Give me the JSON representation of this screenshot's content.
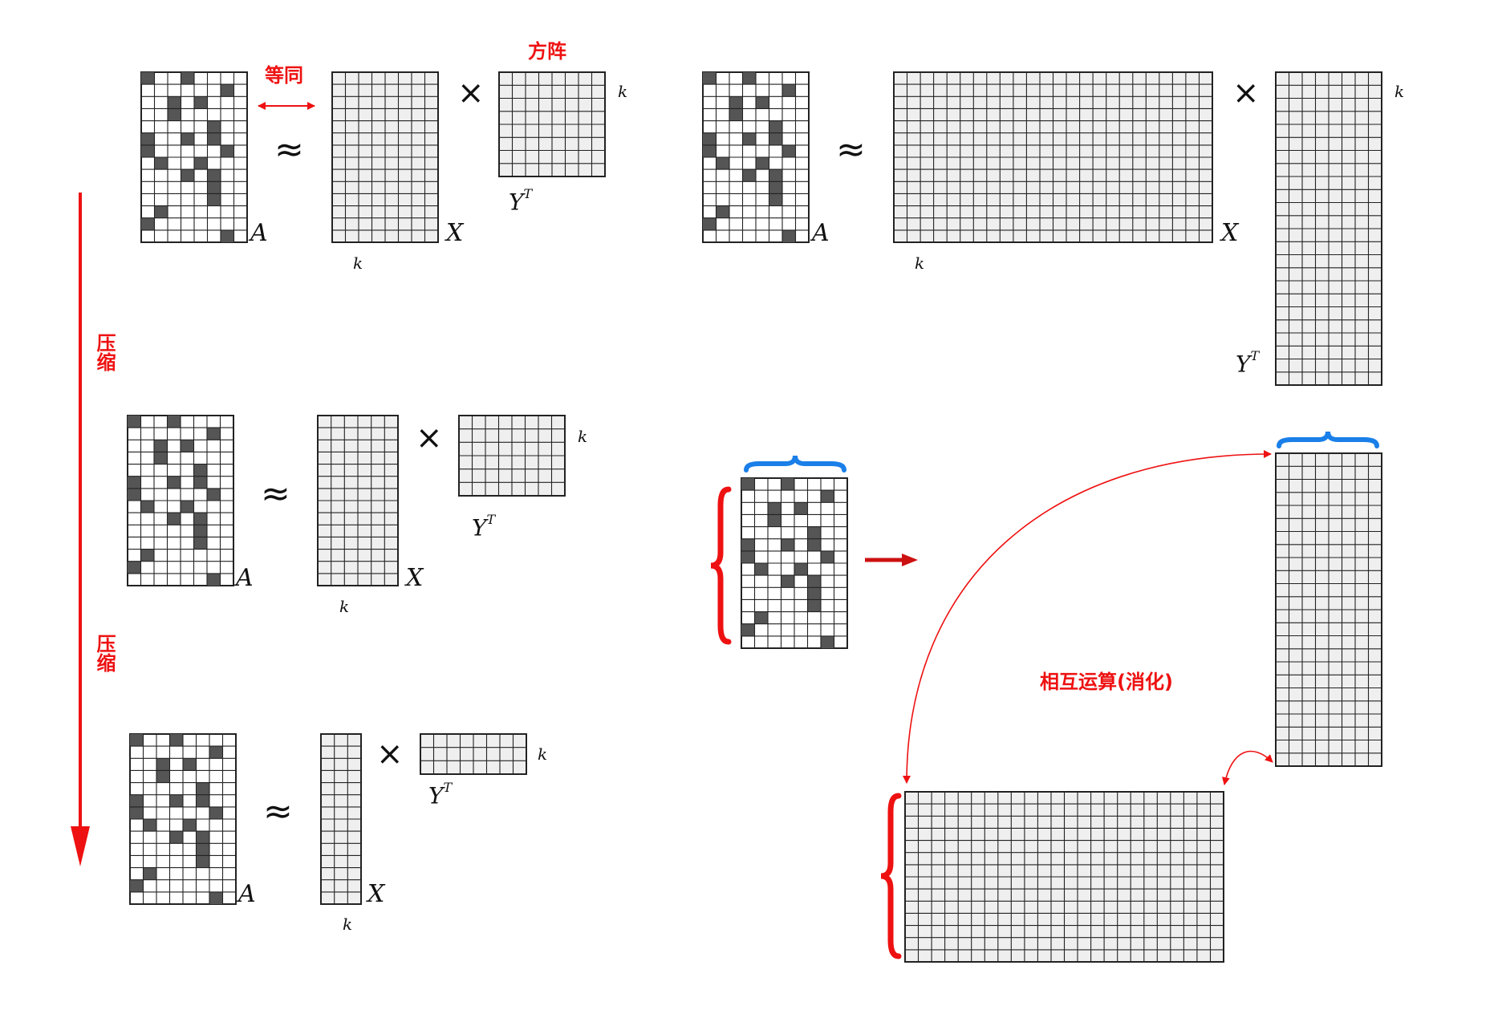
{
  "labels": {
    "A": "A",
    "X": "X",
    "Y": "Y",
    "T": "T",
    "k": "k",
    "approx": "≈",
    "times": "×"
  },
  "annotations": {
    "equivalent": "等同",
    "square_matrix": "方阵",
    "compress": "压缩",
    "mutual_cancellation": "相互运算(消化)"
  },
  "colors": {
    "annotation": "#ee1111",
    "brace_blue": "#1a7fe8",
    "cell_filled": "#555555",
    "cell_light": "#efefef",
    "grid_line": "#222222"
  },
  "matrix_A_filled_cells": [
    [
      0,
      0
    ],
    [
      0,
      3
    ],
    [
      1,
      6
    ],
    [
      2,
      2
    ],
    [
      2,
      4
    ],
    [
      3,
      2
    ],
    [
      4,
      5
    ],
    [
      5,
      0
    ],
    [
      5,
      3
    ],
    [
      5,
      5
    ],
    [
      6,
      0
    ],
    [
      6,
      6
    ],
    [
      7,
      1
    ],
    [
      7,
      4
    ],
    [
      8,
      3
    ],
    [
      8,
      5
    ],
    [
      9,
      5
    ],
    [
      10,
      5
    ],
    [
      11,
      1
    ],
    [
      12,
      0
    ],
    [
      13,
      6
    ]
  ]
}
